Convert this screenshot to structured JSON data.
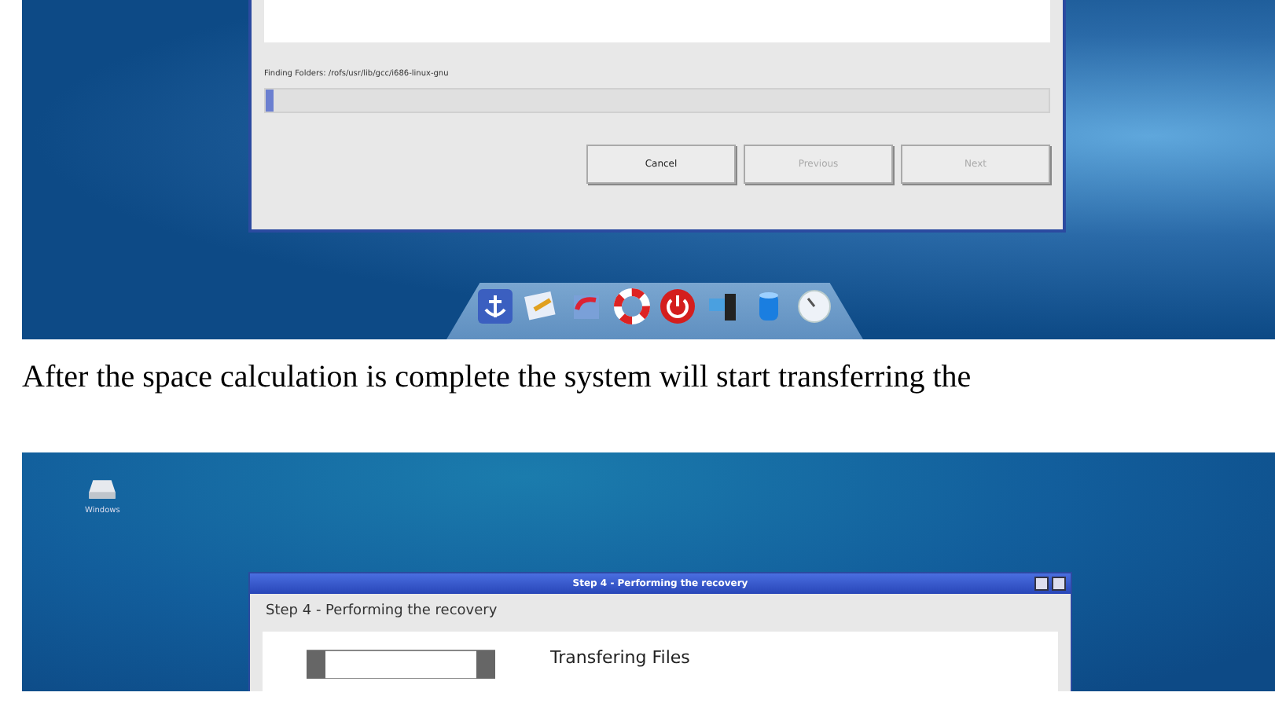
{
  "screenshot_1": {
    "dialog": {
      "status": "Finding Folders: /rofs/usr/lib/gcc/i686-linux-gnu",
      "progress": {
        "level": 0.01
      },
      "buttons": [
        {
          "label": "Cancel",
          "disabled": false
        },
        {
          "label": "Previous",
          "disabled": true
        },
        {
          "label": "Next",
          "disabled": true
        }
      ]
    }
  },
  "paragraph": "After the space calculation is complete the system will start transferring the",
  "screenshot_2": {
    "desktop_icon": {
      "label": "Windows"
    },
    "dialog": {
      "title": "Step 4 - Performing the recovery",
      "heading": "Step 4 - Performing the recovery",
      "section_title": "Transfering Files"
    }
  }
}
